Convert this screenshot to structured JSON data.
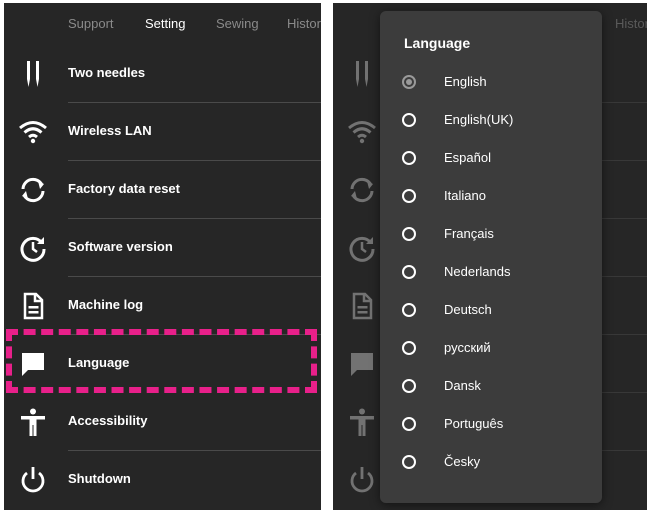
{
  "tabs": [
    {
      "label": "Support",
      "active": false
    },
    {
      "label": "Setting",
      "active": true
    },
    {
      "label": "Sewing",
      "active": false
    },
    {
      "label": "History",
      "active": false
    }
  ],
  "menu_items": [
    {
      "label": "Two needles",
      "icon": "two-needles-icon"
    },
    {
      "label": "Wireless LAN",
      "icon": "wifi-icon"
    },
    {
      "label": "Factory data reset",
      "icon": "reset-icon"
    },
    {
      "label": "Software version",
      "icon": "software-update-icon"
    },
    {
      "label": "Machine log",
      "icon": "document-icon"
    },
    {
      "label": "Language",
      "icon": "chat-bubble-icon",
      "highlighted": true
    },
    {
      "label": "Accessibility",
      "icon": "accessibility-icon"
    },
    {
      "label": "Shutdown",
      "icon": "power-icon"
    }
  ],
  "highlight_color": "#e8208a",
  "language_dialog": {
    "title": "Language",
    "selected": "English",
    "options": [
      "English",
      "English(UK)",
      "Español",
      "Italiano",
      "Français",
      "Nederlands",
      "Deutsch",
      "русский",
      "Dansk",
      "Português",
      "Česky"
    ]
  },
  "right_peek_tab": "Histor"
}
